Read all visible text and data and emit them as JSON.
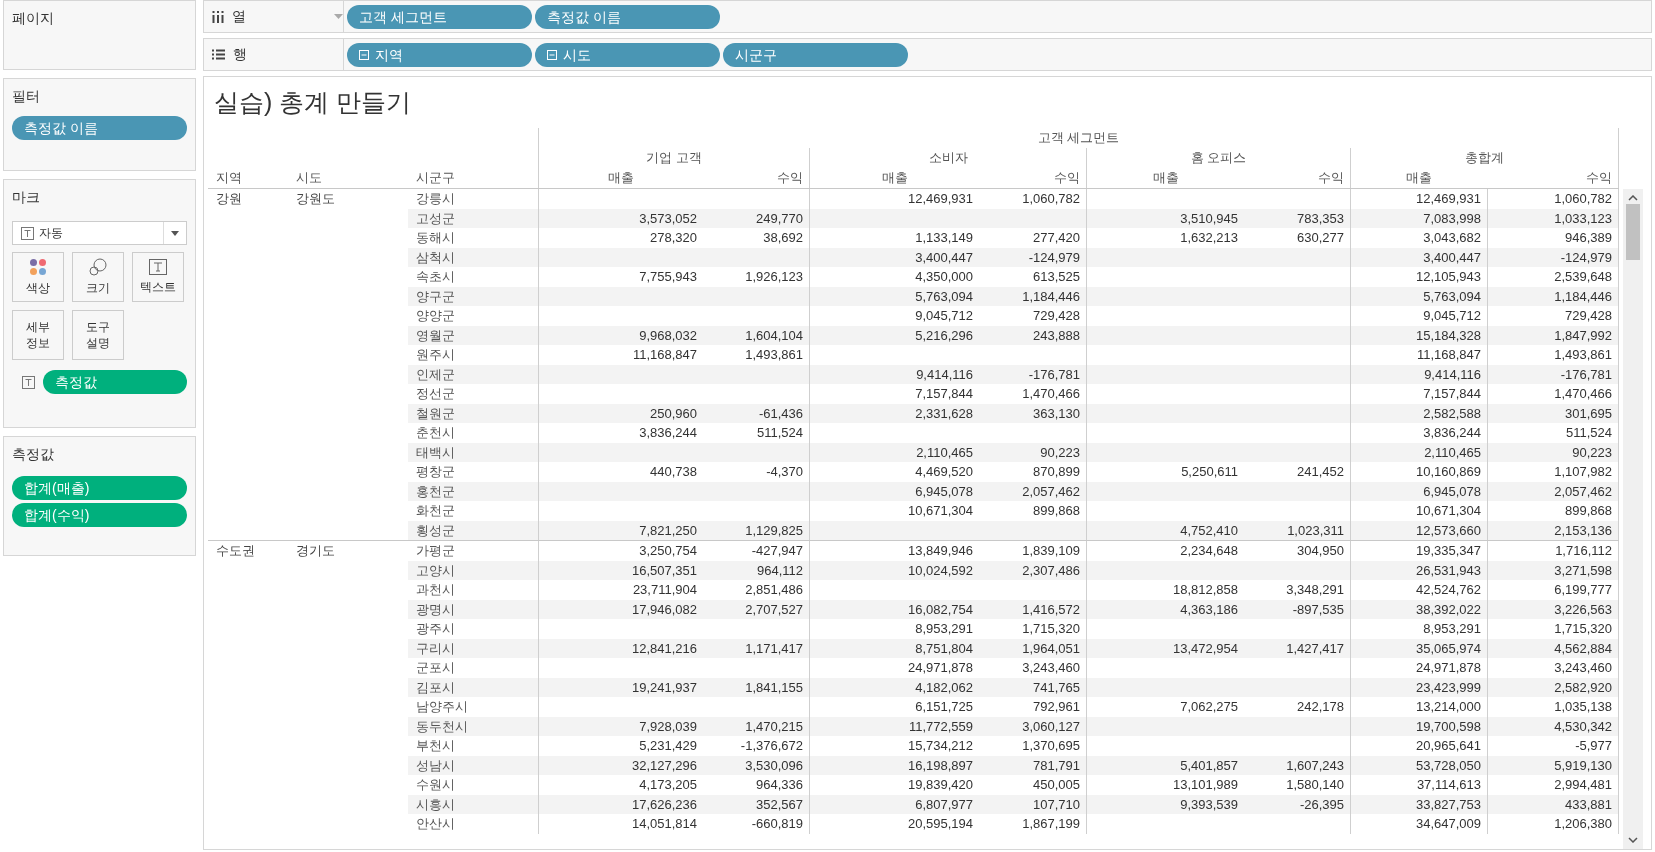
{
  "shelves": {
    "columns": {
      "label": "열",
      "pills": [
        {
          "label": "고객 세그먼트",
          "collapsible": false
        },
        {
          "label": "측정값 이름",
          "collapsible": false
        }
      ]
    },
    "rows": {
      "label": "행",
      "pills": [
        {
          "label": "지역",
          "collapsible": true
        },
        {
          "label": "시도",
          "collapsible": true
        },
        {
          "label": "시군구",
          "collapsible": false
        }
      ]
    }
  },
  "cards": {
    "pages": {
      "title": "페이지"
    },
    "filters": {
      "title": "필터",
      "pills": [
        "측정값 이름"
      ]
    },
    "marks": {
      "title": "마크",
      "mark_type": {
        "label": "자동",
        "kind": "text"
      },
      "buttons": [
        {
          "label": "색상",
          "kind": "color"
        },
        {
          "label": "크기",
          "kind": "size"
        },
        {
          "label": "텍스트",
          "kind": "text"
        },
        {
          "label": "세부 정보",
          "kind": "plain"
        },
        {
          "label": "도구 설명",
          "kind": "plain"
        }
      ],
      "pills": [
        {
          "label": "측정값",
          "kind": "text"
        }
      ]
    },
    "measures": {
      "title": "측정값",
      "pills": [
        "합계(매출)",
        "합계(수익)"
      ]
    }
  },
  "view": {
    "title": "실습) 총계 만들기",
    "column_header": "고객 세그먼트",
    "row_headers": [
      "지역",
      "시도",
      "시군구"
    ],
    "segments": [
      {
        "name": "기업 고객",
        "measures": [
          "매출",
          "수익"
        ]
      },
      {
        "name": "소비자",
        "measures": [
          "매출",
          "수익"
        ]
      },
      {
        "name": "홈 오피스",
        "measures": [
          "매출",
          "수익"
        ]
      },
      {
        "name": "총합계",
        "measures": [
          "매출",
          "수익"
        ]
      }
    ],
    "regions": [
      {
        "name": "강원",
        "provinces": [
          {
            "name": "강원도",
            "cities": [
              {
                "name": "강릉시",
                "consumer_sales": "12,469,931",
                "consumer_profit": "1,060,782",
                "total_sales": "12,469,931",
                "total_profit": "1,060,782"
              },
              {
                "name": "고성군",
                "corporate_sales": "3,573,052",
                "corporate_profit": "249,770",
                "home_office_sales": "3,510,945",
                "home_office_profit": "783,353",
                "total_sales": "7,083,998",
                "total_profit": "1,033,123"
              },
              {
                "name": "동해시",
                "corporate_sales": "278,320",
                "corporate_profit": "38,692",
                "consumer_sales": "1,133,149",
                "consumer_profit": "277,420",
                "home_office_sales": "1,632,213",
                "home_office_profit": "630,277",
                "total_sales": "3,043,682",
                "total_profit": "946,389"
              },
              {
                "name": "삼척시",
                "consumer_sales": "3,400,447",
                "consumer_profit": "-124,979",
                "total_sales": "3,400,447",
                "total_profit": "-124,979"
              },
              {
                "name": "속초시",
                "corporate_sales": "7,755,943",
                "corporate_profit": "1,926,123",
                "consumer_sales": "4,350,000",
                "consumer_profit": "613,525",
                "total_sales": "12,105,943",
                "total_profit": "2,539,648"
              },
              {
                "name": "양구군",
                "consumer_sales": "5,763,094",
                "consumer_profit": "1,184,446",
                "total_sales": "5,763,094",
                "total_profit": "1,184,446"
              },
              {
                "name": "양양군",
                "consumer_sales": "9,045,712",
                "consumer_profit": "729,428",
                "total_sales": "9,045,712",
                "total_profit": "729,428"
              },
              {
                "name": "영월군",
                "corporate_sales": "9,968,032",
                "corporate_profit": "1,604,104",
                "consumer_sales": "5,216,296",
                "consumer_profit": "243,888",
                "total_sales": "15,184,328",
                "total_profit": "1,847,992"
              },
              {
                "name": "원주시",
                "corporate_sales": "11,168,847",
                "corporate_profit": "1,493,861",
                "total_sales": "11,168,847",
                "total_profit": "1,493,861"
              },
              {
                "name": "인제군",
                "consumer_sales": "9,414,116",
                "consumer_profit": "-176,781",
                "total_sales": "9,414,116",
                "total_profit": "-176,781"
              },
              {
                "name": "정선군",
                "consumer_sales": "7,157,844",
                "consumer_profit": "1,470,466",
                "total_sales": "7,157,844",
                "total_profit": "1,470,466"
              },
              {
                "name": "철원군",
                "corporate_sales": "250,960",
                "corporate_profit": "-61,436",
                "consumer_sales": "2,331,628",
                "consumer_profit": "363,130",
                "total_sales": "2,582,588",
                "total_profit": "301,695"
              },
              {
                "name": "춘천시",
                "corporate_sales": "3,836,244",
                "corporate_profit": "511,524",
                "total_sales": "3,836,244",
                "total_profit": "511,524"
              },
              {
                "name": "태백시",
                "consumer_sales": "2,110,465",
                "consumer_profit": "90,223",
                "total_sales": "2,110,465",
                "total_profit": "90,223"
              },
              {
                "name": "평창군",
                "corporate_sales": "440,738",
                "corporate_profit": "-4,370",
                "consumer_sales": "4,469,520",
                "consumer_profit": "870,899",
                "home_office_sales": "5,250,611",
                "home_office_profit": "241,452",
                "total_sales": "10,160,869",
                "total_profit": "1,107,982"
              },
              {
                "name": "홍천군",
                "consumer_sales": "6,945,078",
                "consumer_profit": "2,057,462",
                "total_sales": "6,945,078",
                "total_profit": "2,057,462"
              },
              {
                "name": "화천군",
                "consumer_sales": "10,671,304",
                "consumer_profit": "899,868",
                "total_sales": "10,671,304",
                "total_profit": "899,868"
              },
              {
                "name": "횡성군",
                "corporate_sales": "7,821,250",
                "corporate_profit": "1,129,825",
                "home_office_sales": "4,752,410",
                "home_office_profit": "1,023,311",
                "total_sales": "12,573,660",
                "total_profit": "2,153,136"
              }
            ]
          }
        ]
      },
      {
        "name": "수도권",
        "provinces": [
          {
            "name": "경기도",
            "cities": [
              {
                "name": "가평군",
                "corporate_sales": "3,250,754",
                "corporate_profit": "-427,947",
                "consumer_sales": "13,849,946",
                "consumer_profit": "1,839,109",
                "home_office_sales": "2,234,648",
                "home_office_profit": "304,950",
                "total_sales": "19,335,347",
                "total_profit": "1,716,112"
              },
              {
                "name": "고양시",
                "corporate_sales": "16,507,351",
                "corporate_profit": "964,112",
                "consumer_sales": "10,024,592",
                "consumer_profit": "2,307,486",
                "total_sales": "26,531,943",
                "total_profit": "3,271,598"
              },
              {
                "name": "과천시",
                "corporate_sales": "23,711,904",
                "corporate_profit": "2,851,486",
                "home_office_sales": "18,812,858",
                "home_office_profit": "3,348,291",
                "total_sales": "42,524,762",
                "total_profit": "6,199,777"
              },
              {
                "name": "광명시",
                "corporate_sales": "17,946,082",
                "corporate_profit": "2,707,527",
                "consumer_sales": "16,082,754",
                "consumer_profit": "1,416,572",
                "home_office_sales": "4,363,186",
                "home_office_profit": "-897,535",
                "total_sales": "38,392,022",
                "total_profit": "3,226,563"
              },
              {
                "name": "광주시",
                "consumer_sales": "8,953,291",
                "consumer_profit": "1,715,320",
                "total_sales": "8,953,291",
                "total_profit": "1,715,320"
              },
              {
                "name": "구리시",
                "corporate_sales": "12,841,216",
                "corporate_profit": "1,171,417",
                "consumer_sales": "8,751,804",
                "consumer_profit": "1,964,051",
                "home_office_sales": "13,472,954",
                "home_office_profit": "1,427,417",
                "total_sales": "35,065,974",
                "total_profit": "4,562,884"
              },
              {
                "name": "군포시",
                "consumer_sales": "24,971,878",
                "consumer_profit": "3,243,460",
                "total_sales": "24,971,878",
                "total_profit": "3,243,460"
              },
              {
                "name": "김포시",
                "corporate_sales": "19,241,937",
                "corporate_profit": "1,841,155",
                "consumer_sales": "4,182,062",
                "consumer_profit": "741,765",
                "total_sales": "23,423,999",
                "total_profit": "2,582,920"
              },
              {
                "name": "남양주시",
                "consumer_sales": "6,151,725",
                "consumer_profit": "792,961",
                "home_office_sales": "7,062,275",
                "home_office_profit": "242,178",
                "total_sales": "13,214,000",
                "total_profit": "1,035,138"
              },
              {
                "name": "동두천시",
                "corporate_sales": "7,928,039",
                "corporate_profit": "1,470,215",
                "consumer_sales": "11,772,559",
                "consumer_profit": "3,060,127",
                "total_sales": "19,700,598",
                "total_profit": "4,530,342"
              },
              {
                "name": "부천시",
                "corporate_sales": "5,231,429",
                "corporate_profit": "-1,376,672",
                "consumer_sales": "15,734,212",
                "consumer_profit": "1,370,695",
                "total_sales": "20,965,641",
                "total_profit": "-5,977"
              },
              {
                "name": "성남시",
                "corporate_sales": "32,127,296",
                "corporate_profit": "3,530,096",
                "consumer_sales": "16,198,897",
                "consumer_profit": "781,791",
                "home_office_sales": "5,401,857",
                "home_office_profit": "1,607,243",
                "total_sales": "53,728,050",
                "total_profit": "5,919,130"
              },
              {
                "name": "수원시",
                "corporate_sales": "4,173,205",
                "corporate_profit": "964,336",
                "consumer_sales": "19,839,420",
                "consumer_profit": "450,005",
                "home_office_sales": "13,101,989",
                "home_office_profit": "1,580,140",
                "total_sales": "37,114,613",
                "total_profit": "2,994,481"
              },
              {
                "name": "시흥시",
                "corporate_sales": "17,626,236",
                "corporate_profit": "352,567",
                "consumer_sales": "6,807,977",
                "consumer_profit": "107,710",
                "home_office_sales": "9,393,539",
                "home_office_profit": "-26,395",
                "total_sales": "33,827,753",
                "total_profit": "433,881"
              },
              {
                "name": "안산시",
                "corporate_sales": "14,051,814",
                "corporate_profit": "-660,819",
                "consumer_sales": "20,595,194",
                "consumer_profit": "1,867,199",
                "total_sales": "34,647,009",
                "total_profit": "1,206,380"
              }
            ]
          }
        ]
      }
    ]
  }
}
